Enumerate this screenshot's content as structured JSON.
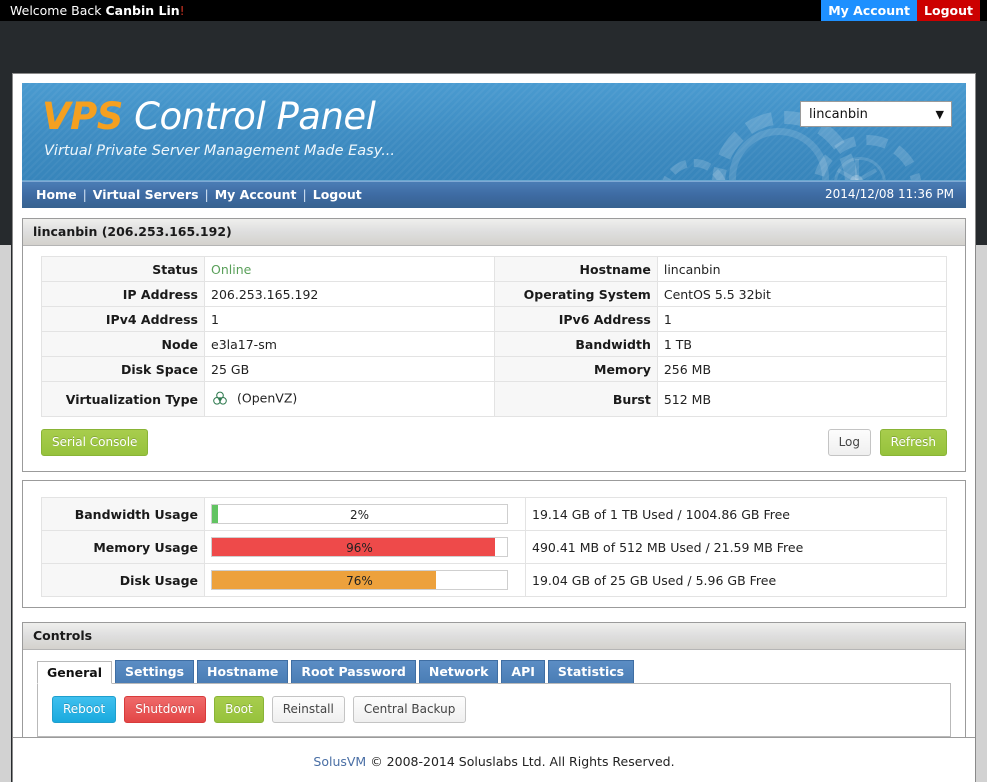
{
  "topbar": {
    "welcome_prefix": "Welcome Back ",
    "welcome_name": "Canbin Lin",
    "welcome_suffix": "!",
    "my_account_label": "My Account",
    "logout_label": "Logout"
  },
  "banner": {
    "logo_accent": "VPS",
    "logo_rest": " Control Panel",
    "tagline": "Virtual Private Server Management Made Easy...",
    "server_select_value": "lincanbin",
    "server_select_arrow": "▼"
  },
  "nav": {
    "items": [
      {
        "label": "Home"
      },
      {
        "label": "Virtual Servers"
      },
      {
        "label": "My Account"
      },
      {
        "label": "Logout"
      }
    ],
    "separator": "|",
    "datetime": "2014/12/08 11:36 PM"
  },
  "server_box": {
    "title": "lincanbin (206.253.165.192)",
    "left_rows": [
      {
        "label": "Status",
        "value": "Online",
        "status": true
      },
      {
        "label": "IP Address",
        "value": "206.253.165.192"
      },
      {
        "label": "IPv4 Address",
        "value": "1"
      },
      {
        "label": "Node",
        "value": "e3la17-sm"
      },
      {
        "label": "Disk Space",
        "value": "25 GB"
      },
      {
        "label": "Virtualization Type",
        "value": "(OpenVZ)",
        "icon": "openvz-icon"
      }
    ],
    "right_rows": [
      {
        "label": "Hostname",
        "value": "lincanbin"
      },
      {
        "label": "Operating System",
        "value": "CentOS 5.5 32bit"
      },
      {
        "label": "IPv6 Address",
        "value": "1"
      },
      {
        "label": "Bandwidth",
        "value": "1 TB"
      },
      {
        "label": "Memory",
        "value": "256 MB"
      },
      {
        "label": "Burst",
        "value": "512 MB"
      }
    ],
    "buttons": {
      "serial_console": "Serial Console",
      "log": "Log",
      "refresh": "Refresh"
    }
  },
  "usage": {
    "rows": [
      {
        "label": "Bandwidth Usage",
        "percent": 2,
        "percent_label": "2%",
        "color": "#62c462",
        "detail": "19.14 GB of 1 TB Used / 1004.86 GB Free"
      },
      {
        "label": "Memory Usage",
        "percent": 96,
        "percent_label": "96%",
        "color": "#ee4a4a",
        "detail": "490.41 MB of 512 MB Used / 21.59 MB Free"
      },
      {
        "label": "Disk Usage",
        "percent": 76,
        "percent_label": "76%",
        "color": "#eda13c",
        "detail": "19.04 GB of 25 GB Used / 5.96 GB Free"
      }
    ]
  },
  "controls": {
    "title": "Controls",
    "tabs": [
      {
        "label": "General",
        "active": true
      },
      {
        "label": "Settings",
        "active": false
      },
      {
        "label": "Hostname",
        "active": false
      },
      {
        "label": "Root Password",
        "active": false
      },
      {
        "label": "Network",
        "active": false
      },
      {
        "label": "API",
        "active": false
      },
      {
        "label": "Statistics",
        "active": false
      }
    ],
    "actions": [
      {
        "label": "Reboot",
        "style": "btn-blue"
      },
      {
        "label": "Shutdown",
        "style": "btn-red"
      },
      {
        "label": "Boot",
        "style": "btn-green"
      },
      {
        "label": "Reinstall",
        "style": "btn-grey"
      },
      {
        "label": "Central Backup",
        "style": "btn-grey"
      }
    ]
  },
  "footer": {
    "brand": "SolusVM",
    "text": " © 2008-2014 Soluslabs Ltd. All Rights Reserved."
  },
  "colors": {
    "accent_orange": "#f5a020",
    "banner_blue": "#3e8cc2",
    "nav_blue": "#3e6ba3",
    "status_green": "#5aa05a",
    "logout_red": "#cc0000",
    "myaccount_blue": "#1e90ff"
  }
}
